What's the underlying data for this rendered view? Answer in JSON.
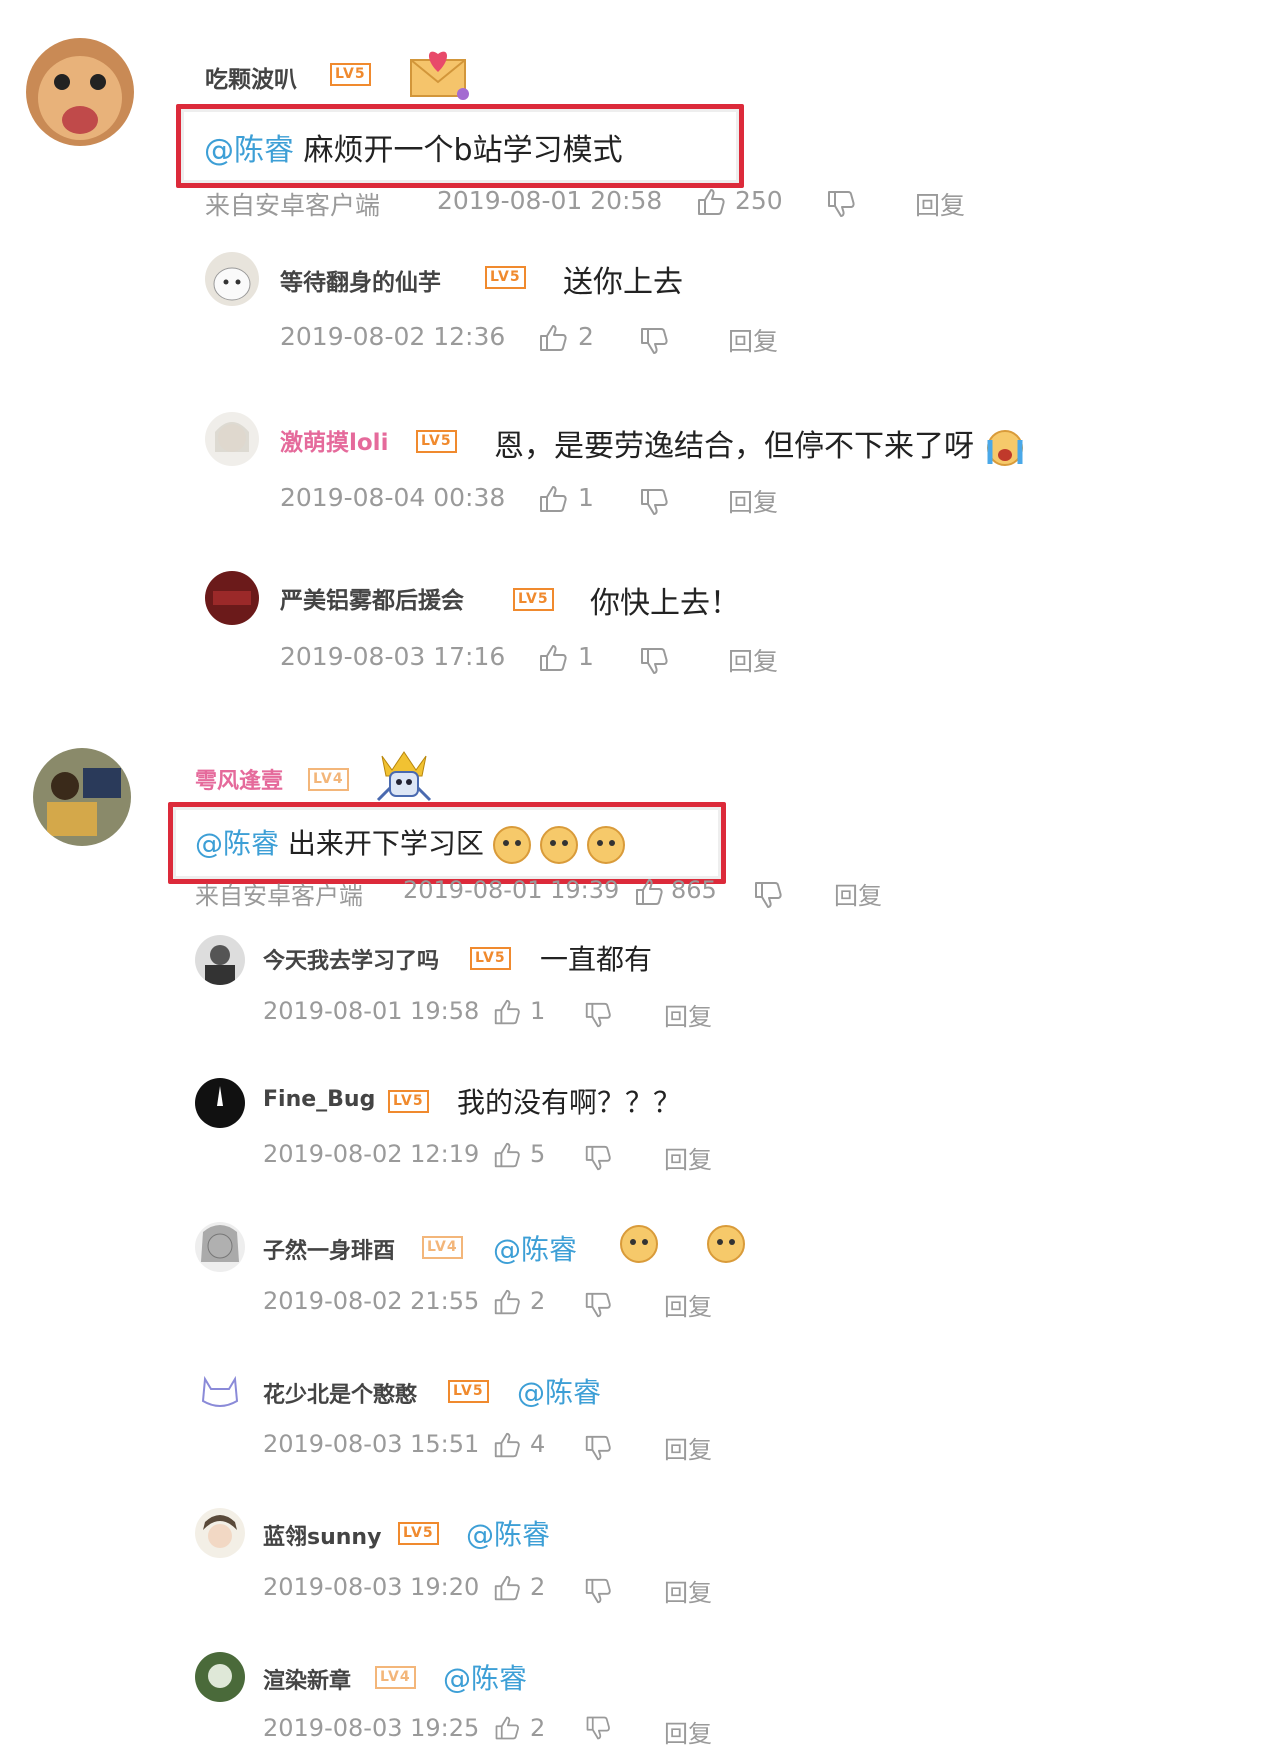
{
  "threads": [
    {
      "user": "吃颗波叭",
      "level": "LV5",
      "mention": "@陈睿",
      "text": " 麻烦开一个b站学习模式",
      "source": "来自安卓客户端",
      "time": "2019-08-01 20:58",
      "likes": "250",
      "reply_label": "回复",
      "replies": [
        {
          "user": "等待翻身的仙芋",
          "level": "LV5",
          "text": "送你上去",
          "time": "2019-08-02 12:36",
          "likes": "2",
          "reply_label": "回复"
        },
        {
          "user": "激萌摸loli",
          "level": "LV5",
          "text": "恩，是要劳逸结合，但停不下来了呀",
          "time": "2019-08-04 00:38",
          "likes": "1",
          "reply_label": "回复"
        },
        {
          "user": "严美铝雾都后援会",
          "level": "LV5",
          "text": "你快上去！",
          "time": "2019-08-03 17:16",
          "likes": "1",
          "reply_label": "回复"
        }
      ]
    },
    {
      "user": "雩风逢壹",
      "level": "LV4",
      "mention": "@陈睿",
      "text": " 出来开下学习区",
      "source": "来自安卓客户端",
      "time": "2019-08-01 19:39",
      "likes": "865",
      "reply_label": "回复",
      "replies": [
        {
          "user": "今天我去学习了吗",
          "level": "LV5",
          "text": "一直都有",
          "time": "2019-08-01 19:58",
          "likes": "1",
          "reply_label": "回复"
        },
        {
          "user": "Fine_Bug",
          "level": "LV5",
          "text": "我的没有啊？？？",
          "time": "2019-08-02 12:19",
          "likes": "5",
          "reply_label": "回复"
        },
        {
          "user": "子然一身琲酉",
          "level": "LV4",
          "mention": "@陈睿",
          "time": "2019-08-02 21:55",
          "likes": "2",
          "reply_label": "回复"
        },
        {
          "user": "花少北是个憨憨",
          "level": "LV5",
          "mention": "@陈睿",
          "time": "2019-08-03 15:51",
          "likes": "4",
          "reply_label": "回复"
        },
        {
          "user": "蓝翎sunny",
          "level": "LV5",
          "mention": "@陈睿",
          "time": "2019-08-03 19:20",
          "likes": "2",
          "reply_label": "回复"
        },
        {
          "user": "渲染新章",
          "level": "LV4",
          "mention": "@陈睿",
          "time": "2019-08-03 19:25",
          "likes": "2",
          "reply_label": "回复"
        }
      ]
    }
  ],
  "colors": {
    "mention": "#3d9fd6",
    "highlight_box": "#dc2a3a",
    "level_badge": "#f08a2e"
  }
}
